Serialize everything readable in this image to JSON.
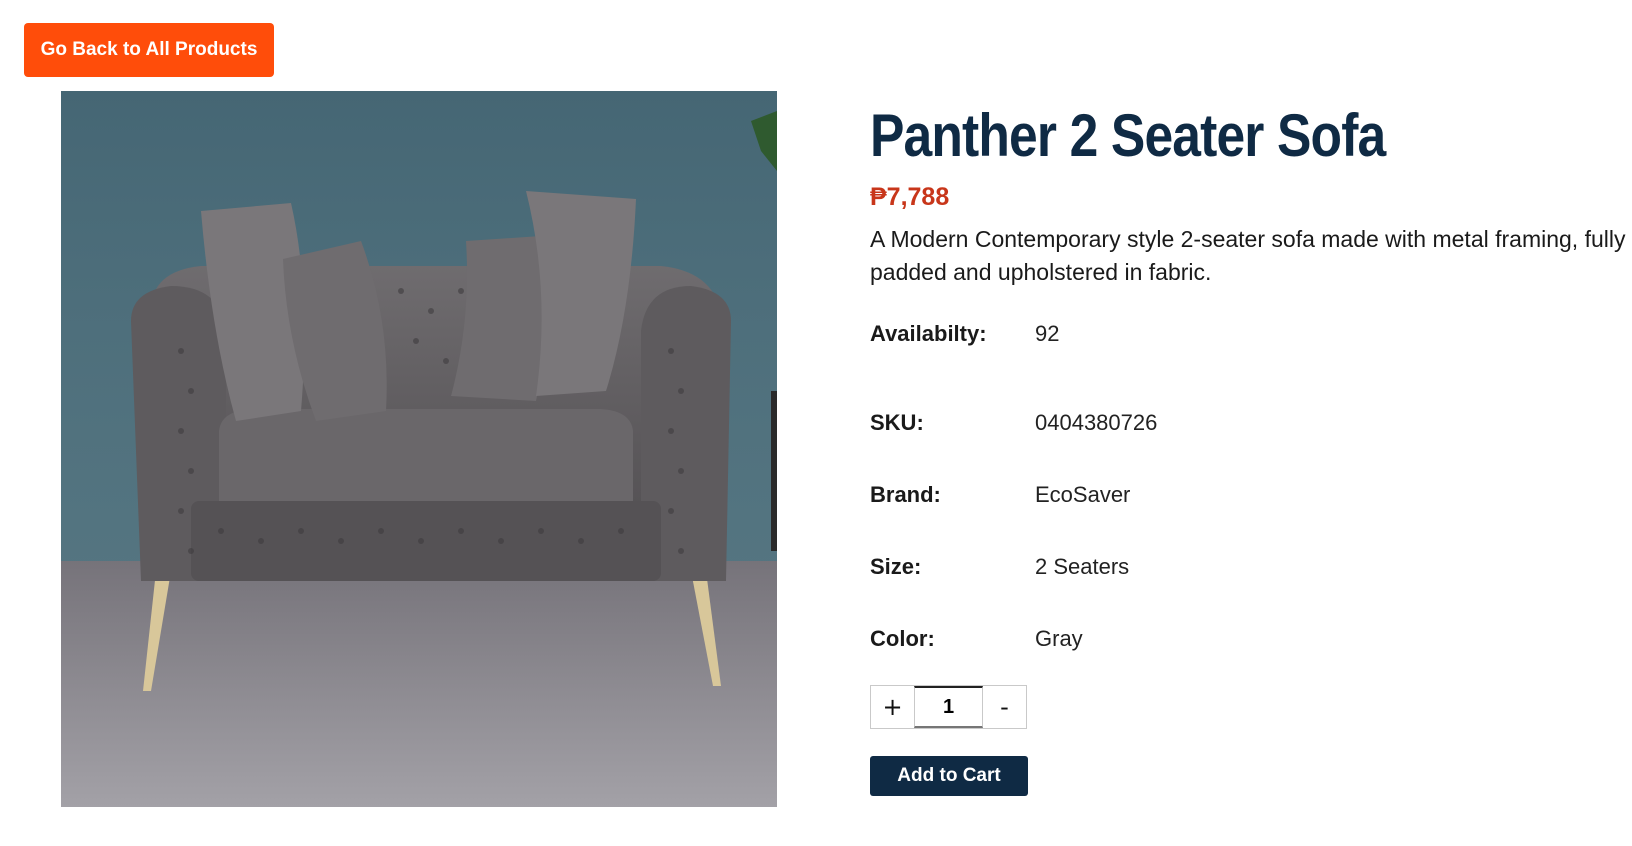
{
  "nav": {
    "back_label": "Go Back to All Products"
  },
  "product": {
    "title": "Panther 2 Seater Sofa",
    "price": "₱7,788",
    "description": "A Modern Contemporary style 2-seater sofa made with metal framing, fully padded and upholstered in fabric.",
    "image_subject": "gray tufted velvet 2-seater sofa with gold metal legs",
    "attributes": [
      {
        "label": "Availabilty:",
        "value": "92"
      },
      {
        "label": "SKU:",
        "value": "0404380726"
      },
      {
        "label": "Brand:",
        "value": "EcoSaver"
      },
      {
        "label": "Size:",
        "value": "2 Seaters"
      },
      {
        "label": "Color:",
        "value": "Gray"
      }
    ]
  },
  "quantity": {
    "increment": "+",
    "value": "1",
    "decrement": "-"
  },
  "cart": {
    "add_label": "Add to Cart"
  },
  "colors": {
    "back_button": "#ff4d0a",
    "title": "#0f2a44",
    "price": "#c8361a",
    "cart_button": "#0f2a44"
  }
}
